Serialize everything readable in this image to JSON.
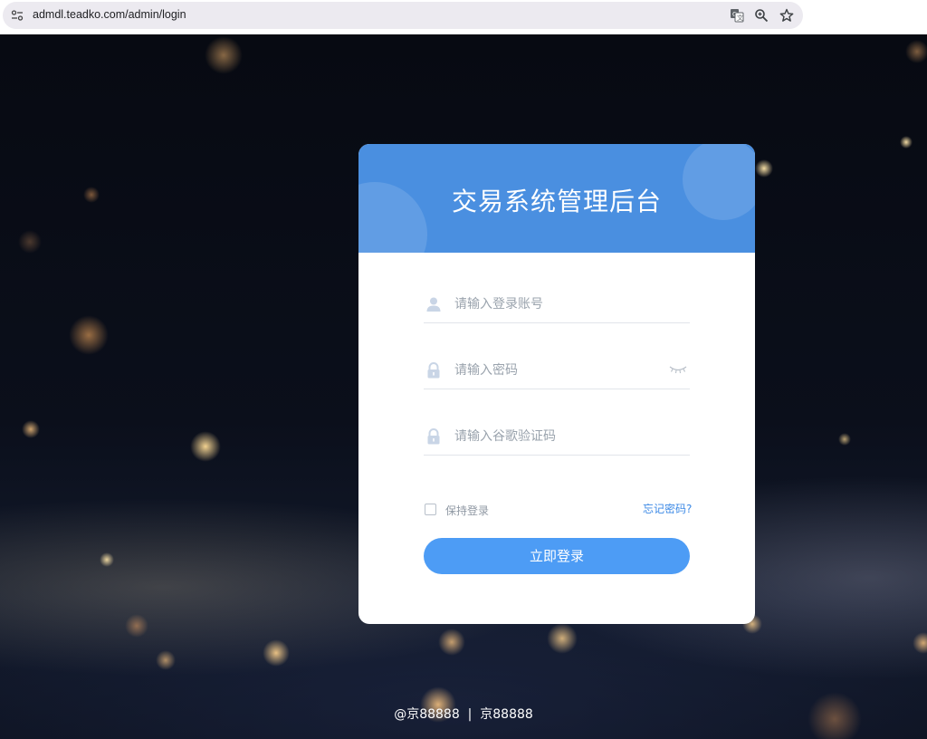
{
  "browser": {
    "url": "admdl.teadko.com/admin/login",
    "icons": [
      "site-info-icon",
      "translate-icon",
      "zoom-icon",
      "bookmark-star-icon"
    ]
  },
  "login": {
    "title": "交易系统管理后台",
    "username_placeholder": "请输入登录账号",
    "password_placeholder": "请输入密码",
    "captcha_placeholder": "请输入谷歌验证码",
    "remember_label": "保持登录",
    "forgot_label": "忘记密码?",
    "submit_label": "立即登录"
  },
  "footer": {
    "text": "@京88888  |  京88888"
  },
  "colors": {
    "header_blue": "#4a8fe0",
    "button_blue": "#4d9cf5",
    "link_blue": "#3d8ae6"
  }
}
